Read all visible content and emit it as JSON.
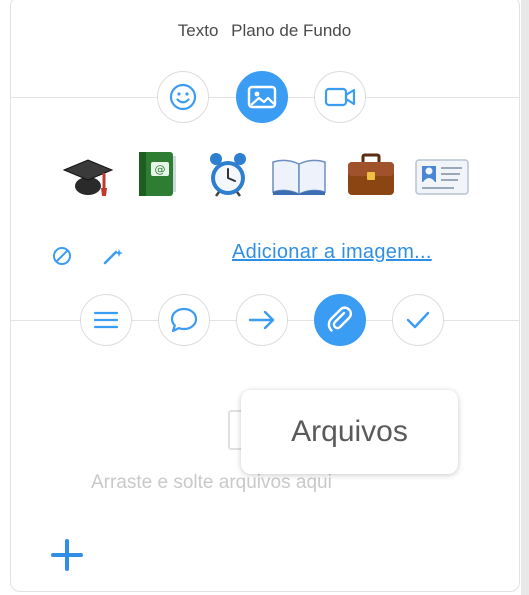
{
  "tabs": {
    "text": "Texto",
    "background": "Plano de Fundo"
  },
  "media_buttons": [
    {
      "icon": "smiley-icon",
      "active": false
    },
    {
      "icon": "image-icon",
      "active": true
    },
    {
      "icon": "video-icon",
      "active": false
    }
  ],
  "background_images": [
    "graduation-cap-icon",
    "address-book-icon",
    "alarm-clock-icon",
    "open-book-icon",
    "briefcase-icon",
    "business-card-icon"
  ],
  "actions": {
    "add_image_link": "Adicionar a imagem..."
  },
  "type_buttons": [
    {
      "icon": "text-lines-icon",
      "active": false
    },
    {
      "icon": "speech-bubble-icon",
      "active": false
    },
    {
      "icon": "arrow-right-icon",
      "active": false
    },
    {
      "icon": "paperclip-icon",
      "active": true
    },
    {
      "icon": "checkmark-icon",
      "active": false
    }
  ],
  "dropzone": {
    "placeholder": "Arraste e solte arquivos aqui"
  },
  "tooltip": {
    "label": "Arquivos"
  },
  "colors": {
    "accent": "#3b9cf3",
    "link": "#2f8fe6"
  }
}
